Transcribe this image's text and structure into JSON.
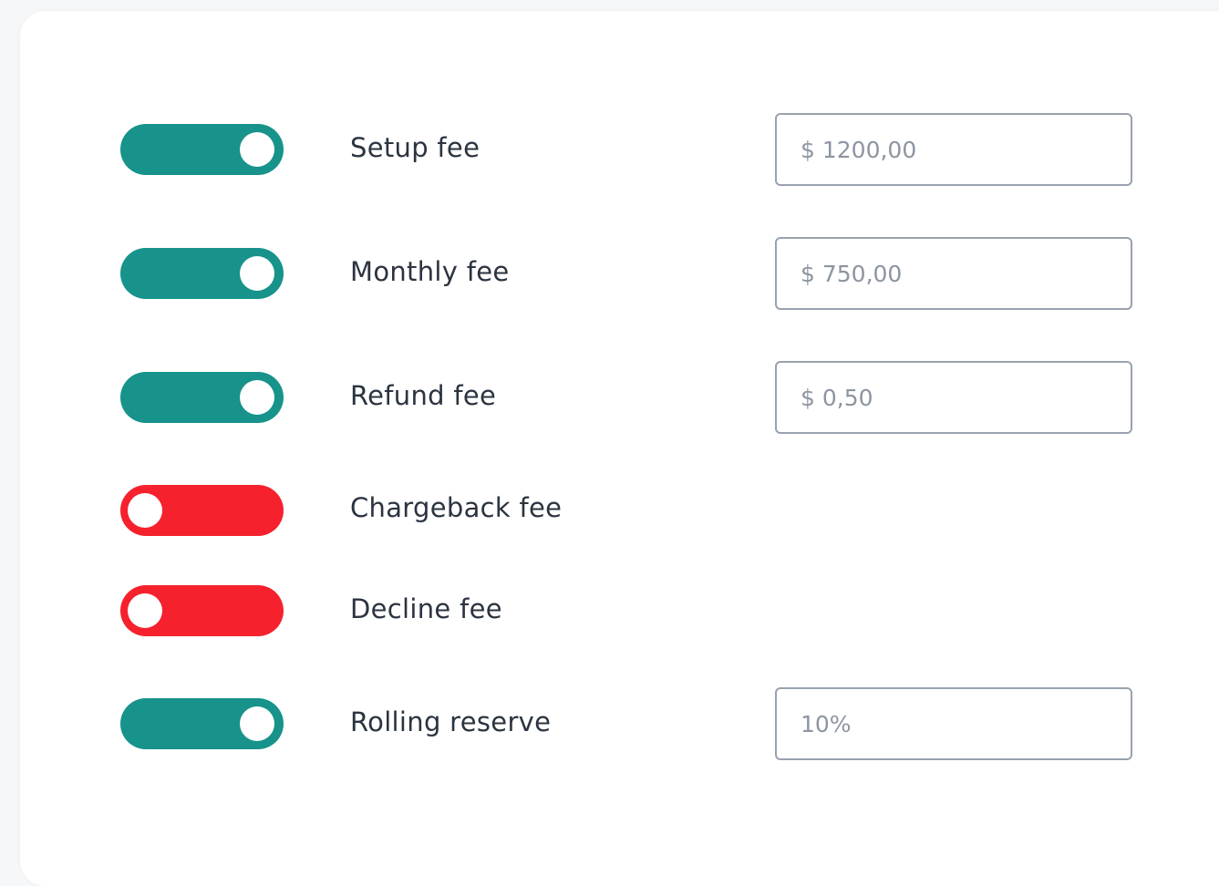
{
  "fees": [
    {
      "label": "Setup fee",
      "enabled": true,
      "placeholder": "$ 1200,00",
      "has_input": true
    },
    {
      "label": "Monthly fee",
      "enabled": true,
      "placeholder": "$ 750,00",
      "has_input": true
    },
    {
      "label": "Refund fee",
      "enabled": true,
      "placeholder": "$ 0,50",
      "has_input": true
    },
    {
      "label": "Chargeback fee",
      "enabled": false,
      "has_input": false
    },
    {
      "label": "Decline fee",
      "enabled": false,
      "has_input": false
    },
    {
      "label": "Rolling reserve",
      "enabled": true,
      "placeholder": "10%",
      "has_input": true
    }
  ],
  "colors": {
    "toggle_on": "#17938b",
    "toggle_off": "#f5222d",
    "label_text": "#2b3440",
    "input_border": "#98a2ae"
  }
}
